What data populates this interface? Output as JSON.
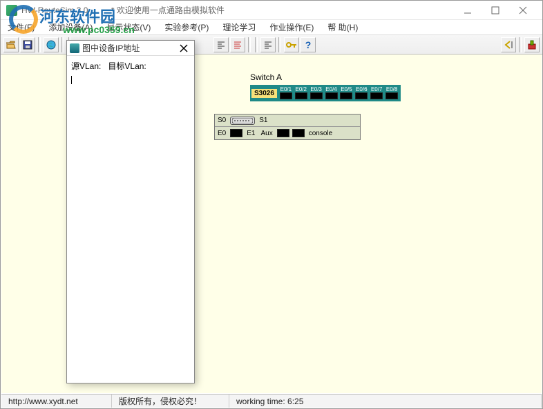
{
  "window": {
    "app_title": "HW-RouteSim 3.0",
    "doc_title": "* 欢迎使用一点通路由模拟软件"
  },
  "menu": {
    "file": "文件(F)",
    "add_dev": "添加设备(A)",
    "show_state": "显示状态(V)",
    "exp_ref": "实验参考(P)",
    "theory": "理论学习",
    "homework": "作业操作(E)",
    "help": "帮 助(H)"
  },
  "dialog": {
    "title": "图中设备IP地址",
    "src_label": "源VLan:",
    "dst_label": "目标VLan:"
  },
  "switch": {
    "label": "Switch A",
    "model": "S3026",
    "ports": [
      "E0/1",
      "E0/2",
      "E0/3",
      "E0/4",
      "E0/5",
      "E0/6",
      "E0/7",
      "E0/8"
    ]
  },
  "router": {
    "s0": "S0",
    "s1": "S1",
    "e0": "E0",
    "e1": "E1",
    "aux": "Aux",
    "console": "console"
  },
  "status": {
    "url": "http://www.xydt.net",
    "copy": "版权所有，侵权必究！",
    "time_label": "working time:",
    "time_value": "6:25"
  },
  "watermark": {
    "brand": "河东软件园",
    "domain": "www.pc0359.cn"
  }
}
